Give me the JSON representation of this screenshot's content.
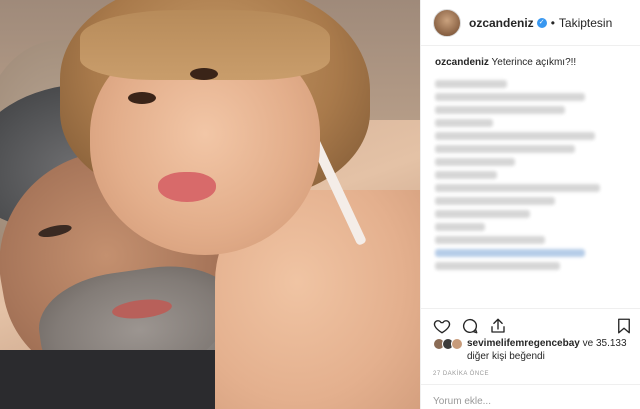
{
  "post": {
    "username": "ozcandeniz",
    "follow_state": "Takiptesin",
    "separator": "•",
    "caption": "Yeterince açıkmı?!!"
  },
  "likes": {
    "first_user": "sevimelifemregencebay",
    "connector": "ve",
    "others": "35.133 diğer kişi beğendi"
  },
  "time_ago": "27 DAKİKA ÖNCE",
  "comment_input": {
    "placeholder": "Yorum ekle..."
  },
  "icons": {
    "verified": "verified-badge-icon",
    "like": "heart-icon",
    "comment": "comment-icon",
    "share": "share-icon",
    "save": "bookmark-icon"
  },
  "colors": {
    "verified_blue": "#3897f0",
    "border": "#efefef",
    "text": "#262626",
    "muted": "#999999"
  }
}
